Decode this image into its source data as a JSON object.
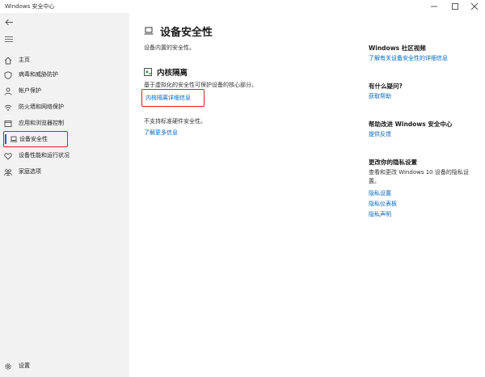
{
  "window": {
    "title": "Windows 安全中心"
  },
  "sidebar": {
    "items": [
      {
        "label": "主页",
        "icon": "home-icon"
      },
      {
        "label": "病毒和威胁防护",
        "icon": "shield-icon"
      },
      {
        "label": "帐户保护",
        "icon": "person-icon"
      },
      {
        "label": "防火墙和网络保护",
        "icon": "wifi-icon"
      },
      {
        "label": "应用和浏览器控制",
        "icon": "app-window-icon"
      },
      {
        "label": "设备安全性",
        "icon": "laptop-icon",
        "selected": true
      },
      {
        "label": "设备性能和运行状况",
        "icon": "heart-icon"
      },
      {
        "label": "家庭选项",
        "icon": "family-icon"
      }
    ],
    "settings_label": "设置"
  },
  "main": {
    "title": "设备安全性",
    "subtitle": "设备内置的安全性。",
    "core_isolation": {
      "title": "内核隔离",
      "description": "基于虚拟化的安全性可保护设备的核心部分。",
      "details_link": "内核隔离详细信息"
    },
    "unsupported_text": "不支持标准硬件安全性。",
    "learn_more_link": "了解更多信息"
  },
  "right_panel": {
    "community": {
      "title": "Windows 社区视频",
      "link": "了解有关设备安全性的详细信息"
    },
    "question": {
      "title": "有什么疑问?",
      "link": "获取帮助"
    },
    "improve": {
      "title": "帮助改进 Windows 安全中心",
      "link": "提供反馈"
    },
    "privacy": {
      "title": "更改你的隐私设置",
      "text": "查看和更改 Windows 10 设备的隐私设置。",
      "links": [
        "隐私设置",
        "隐私仪表板",
        "隐私声明"
      ]
    }
  },
  "colors": {
    "accent": "#0067c0",
    "highlight": "#e02020",
    "sidebar_bg": "#f2f2f2"
  }
}
